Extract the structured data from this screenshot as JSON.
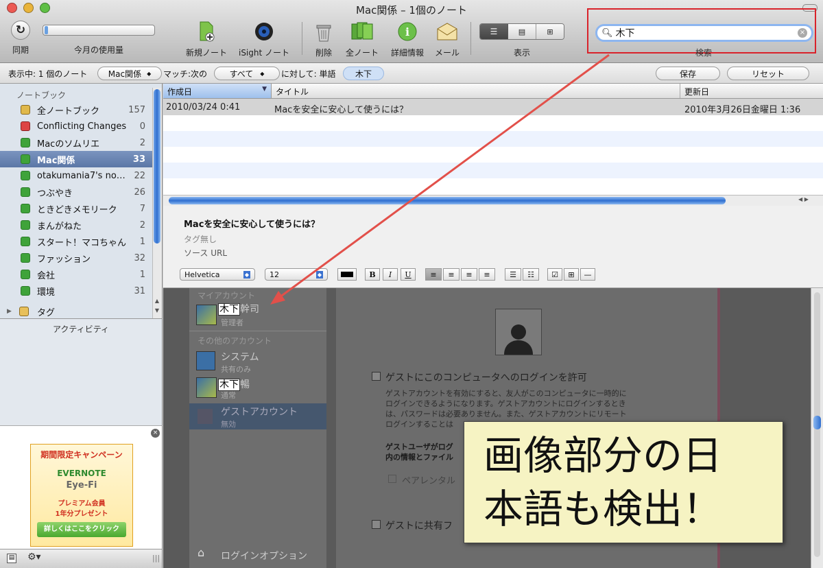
{
  "window": {
    "title": "Mac関係 – 1個のノート"
  },
  "toolbar": {
    "sync": "同期",
    "usage": "今月の使用量",
    "new_note": "新規ノート",
    "isight_note": "iSight ノート",
    "delete": "削除",
    "all_notes": "全ノート",
    "info": "詳細情報",
    "mail": "メール",
    "view": "表示",
    "search_label": "検索",
    "search_value": "木下"
  },
  "filterbar": {
    "showing": "表示中: 1 個のノート",
    "notebook": "Mac関係",
    "match_label": "マッチ:次の",
    "match_value": "すべて",
    "against": "に対して: 単語",
    "term": "木下",
    "save": "保存",
    "reset": "リセット"
  },
  "sidebar": {
    "header": "ノートブック",
    "items": [
      {
        "label": "全ノートブック",
        "count": "157"
      },
      {
        "label": "Conflicting Changes",
        "count": "0"
      },
      {
        "label": "Macのソムリエ",
        "count": "2"
      },
      {
        "label": "Mac関係",
        "count": "33"
      },
      {
        "label": "otakumania7's notebook",
        "count": "22"
      },
      {
        "label": "つぶやき",
        "count": "26"
      },
      {
        "label": "ときどきメモリーク",
        "count": "7"
      },
      {
        "label": "まんがねた",
        "count": "2"
      },
      {
        "label": "スタート！マコちゃん",
        "count": "1"
      },
      {
        "label": "ファッション",
        "count": "32"
      },
      {
        "label": "会社",
        "count": "1"
      },
      {
        "label": "環境",
        "count": "31"
      }
    ],
    "tags": "タグ",
    "activity": "アクティビティ"
  },
  "ad": {
    "campaign": "期間限定キャンペーン",
    "brand": "EVERNOTE",
    "product": "Eye-Fi",
    "line1": "プレミアム会員",
    "line2": "1年分プレゼント",
    "button": "詳しくはここをクリック"
  },
  "list": {
    "col_created": "作成日",
    "col_title": "タイトル",
    "col_updated": "更新日",
    "rows": [
      {
        "created": "2010/03/24 0:41",
        "title": "Macを安全に安心して使うには？",
        "updated": "2010年3月26日金曜日 1:36"
      }
    ]
  },
  "note": {
    "title": "Macを安全に安心して使うには？",
    "tags": "タグ無し",
    "source": "ソース URL",
    "font": "Helvetica",
    "size": "12"
  },
  "accounts": {
    "my_account": "マイアカウント",
    "user1_name_hl": "木下",
    "user1_name_rest": "幹司",
    "user1_role": "管理者",
    "others": "その他のアカウント",
    "system": "システム",
    "system_sub": "共有のみ",
    "user2_name_hl": "木下",
    "user2_name_rest": "暢",
    "user2_role": "通常",
    "guest": "ゲストアカウント",
    "guest_sub": "無効",
    "login_options": "ログインオプション"
  },
  "prefs": {
    "guest_login": "ゲストにこのコンピュータへのログインを許可",
    "desc1": "ゲストアカウントを有効にすると、友人がこのコンピュータに一時的に",
    "desc2": "ログインできるようになります。ゲストアカウントにログインするとき",
    "desc3": "は、パスワードは必要ありません。また、ゲストアカウントにリモート",
    "desc4": "ログインすることは",
    "bold1": "ゲストユーザがログ",
    "bold2": "内の情報とファイル",
    "parental": "ペアレンタル",
    "share": "ゲストに共有フ"
  },
  "callout": {
    "line1": "画像部分の日",
    "line2": "本語も検出！"
  },
  "colors": {
    "accent": "#d9222a",
    "selection": "#5b77a6",
    "callout_bg": "#f6f3c3"
  }
}
